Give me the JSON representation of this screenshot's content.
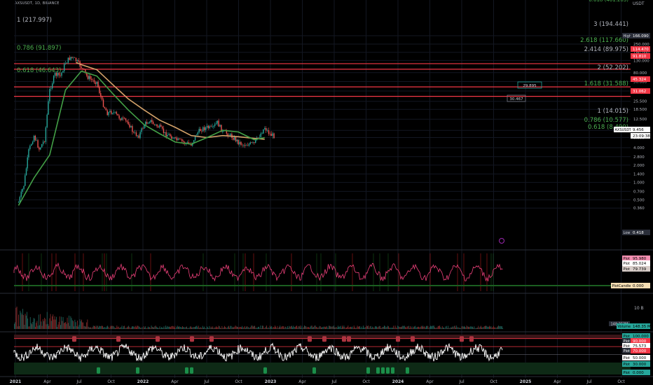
{
  "symbol": "AXSUSDT, 1D, BINANCE",
  "currency": "USDT",
  "colors": {
    "bg": "#000000",
    "up": "#26a69a",
    "down": "#ef5350",
    "fib_red": "#f23645",
    "ma_green": "#43a047",
    "ma_tan": "#d4a26a",
    "fib_text_green": "#4caf50",
    "fib_text_grey": "#b2b5be",
    "rsi_line": "#ffffff"
  },
  "chart_data": {
    "type": "line",
    "title": "",
    "x_ticks": [
      "2021",
      "Apr",
      "Jul",
      "Oct",
      "2022",
      "Apr",
      "Jul",
      "Oct",
      "2023",
      "Apr",
      "Jul",
      "Oct",
      "2024",
      "Apr",
      "Jul",
      "Oct",
      "2025",
      "Apr",
      "Jul",
      "Oct"
    ],
    "y_ticks": [
      "350.000",
      "250.000",
      "180.000",
      "130.000",
      "80.000",
      "56.000",
      "38.500",
      "25.500",
      "18.500",
      "12.500",
      "8.000",
      "6.000",
      "4.000",
      "2.800",
      "2.000",
      "1.400",
      "1.000",
      "0.700",
      "0.500",
      "0.360"
    ],
    "y_scale": "log",
    "price_series": {
      "name": "AXSUSDT",
      "dates": [
        "2021-01",
        "2021-02",
        "2021-03",
        "2021-04",
        "2021-05",
        "2021-06",
        "2021-07",
        "2021-08",
        "2021-09",
        "2021-10",
        "2021-11",
        "2021-12",
        "2022-01",
        "2022-02",
        "2022-03",
        "2022-04",
        "2022-05",
        "2022-06",
        "2022-07",
        "2022-08",
        "2022-09",
        "2022-10",
        "2022-11",
        "2022-12",
        "2023-01",
        "2023-02",
        "2023-03",
        "2023-04",
        "2023-05",
        "2023-06",
        "2023-07",
        "2023-08",
        "2023-09",
        "2023-10",
        "2023-11",
        "2023-12",
        "2024-01",
        "2024-02",
        "2024-03",
        "2024-04",
        "2024-05",
        "2024-06",
        "2024-07",
        "2024-08",
        "2024-09",
        "2024-10",
        "2024-11",
        "2024-12",
        "2025-01",
        "2025-02"
      ],
      "close": [
        0.45,
        0.9,
        3.5,
        6.5,
        3.8,
        5.5,
        40,
        75,
        70,
        120,
        150,
        130,
        100,
        70,
        60,
        55,
        25,
        16,
        17,
        14,
        12,
        11,
        7,
        6.5,
        10,
        12,
        10,
        9,
        7,
        6.5,
        5.5,
        5.2,
        4.8,
        4.6,
        7,
        8.5,
        9,
        8.5,
        11,
        7.5,
        7,
        6,
        5,
        4.5,
        4.6,
        4.7,
        6.5,
        9,
        6.8,
        6.3
      ]
    },
    "ma_green": {
      "dates": [
        "2021-01",
        "2021-04",
        "2021-07",
        "2021-10",
        "2022-01",
        "2022-04",
        "2022-07",
        "2022-10",
        "2023-01",
        "2023-04",
        "2023-07",
        "2023-10",
        "2024-01",
        "2024-04",
        "2024-07",
        "2024-10",
        "2024-12"
      ],
      "values": [
        0.4,
        1.2,
        3,
        40,
        85,
        70,
        35,
        18,
        10,
        7,
        5,
        4.6,
        6,
        8,
        7.5,
        5.5,
        6
      ]
    },
    "ma_tan": {
      "dates": [
        "2021-12",
        "2022-01",
        "2022-04",
        "2022-07",
        "2022-10",
        "2023-01",
        "2023-04",
        "2023-07",
        "2023-10",
        "2024-01",
        "2024-04",
        "2024-07",
        "2024-10",
        "2024-12"
      ],
      "values": [
        120,
        110,
        90,
        50,
        28,
        18,
        12,
        9,
        6.5,
        6,
        6.5,
        6.2,
        5.8,
        5.6
      ]
    },
    "fib_lines": [
      {
        "price": "114.470"
      },
      {
        "price": "91.810"
      },
      {
        "price": "45.324"
      },
      {
        "price": "31.062"
      }
    ],
    "fib_labels_left": [
      {
        "text": "1 (217.997)",
        "color": "grey"
      },
      {
        "text": "0.786 (91.897)",
        "color": "green"
      },
      {
        "text": "0.618 (46.643)",
        "color": "green"
      }
    ],
    "fib_labels_right": [
      {
        "text": "3 (194.441)",
        "color": "grey"
      },
      {
        "text": "2.618 (117.660)",
        "color": "green"
      },
      {
        "text": "2.414 (89.975)",
        "color": "grey"
      },
      {
        "text": "2 (52.202)",
        "color": "grey"
      },
      {
        "text": "1.618 (31.588)",
        "color": "green"
      },
      {
        "text": "1 (14.015)",
        "color": "grey"
      },
      {
        "text": "0.786 (10.577)",
        "color": "green"
      },
      {
        "text": "0.618 (8.490)",
        "color": "green"
      }
    ],
    "top_partial_label": "0.618 (461.203)",
    "price_badges": [
      {
        "text": "High",
        "value": "166.090",
        "color": "#2a2e39"
      },
      {
        "text": "",
        "value": "114.470",
        "color": "#f23645"
      },
      {
        "text": "",
        "value": "91.810",
        "color": "#f23645"
      },
      {
        "text": "",
        "value": "45.324",
        "color": "#f23645"
      },
      {
        "text": "",
        "value": "31.062",
        "color": "#f23645"
      },
      {
        "text": "AXSUSDT",
        "value": "9.456",
        "color": "#ffffff"
      },
      {
        "text": "",
        "value": "23:09:38",
        "color": "#ffffff"
      },
      {
        "text": "Low",
        "value": "0.418",
        "color": "#2a2e39"
      }
    ],
    "boxes": [
      {
        "text": "29.895"
      },
      {
        "text": "30.467"
      }
    ],
    "osc1_badges": [
      {
        "text": "Plot",
        "value": "95.980",
        "color": "#f48fb1"
      },
      {
        "text": "Plot",
        "value": "85.024",
        "color": "#ffffff"
      },
      {
        "text": "Plot",
        "value": "79.739",
        "color": "#d7ccc8"
      },
      {
        "text": "PlotCandle",
        "value": "0.000",
        "color": "#f5deb3"
      }
    ],
    "volume": {
      "tick": "10 B",
      "badge_label": "Volume",
      "badge_value": "148.35 M",
      "left_tag": "148.352M"
    },
    "rsi_badges": [
      {
        "text": "Plot",
        "value": "100.000",
        "color": "#26a69a"
      },
      {
        "text": "Plot",
        "value": "90.000",
        "color": "#f23645"
      },
      {
        "text": "Plot",
        "value": "75.573",
        "color": "#ffffff"
      },
      {
        "text": "Plot",
        "value": "70.000",
        "color": "#f23645"
      },
      {
        "text": "Plot",
        "value": "50.000",
        "color": "#ffffff"
      },
      {
        "text": "Plot",
        "value": "30.000",
        "color": "#26a69a"
      },
      {
        "text": "Plot",
        "value": "0.000",
        "color": "#26a69a"
      }
    ]
  }
}
